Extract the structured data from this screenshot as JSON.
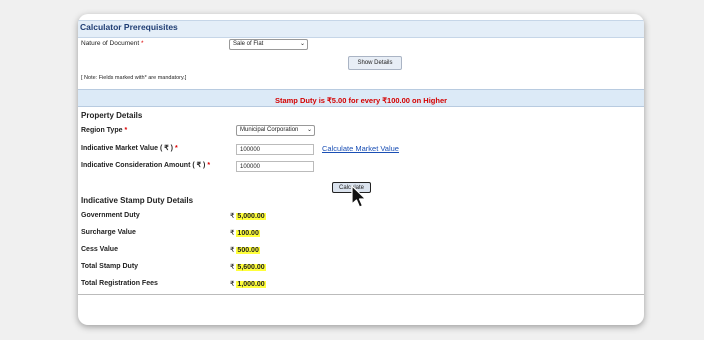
{
  "prereq": {
    "header": "Calculator Prerequisites",
    "nature_label": "Nature of Document",
    "required_mark": "*",
    "nature_value": "Sale of Flat",
    "show_details_button": "Show Details",
    "note": "[ Note: Fields marked with* are mandatory.]"
  },
  "banner": "Stamp Duty is ₹5.00 for every ₹100.00 on Higher",
  "property": {
    "title": "Property Details",
    "region_label": "Region Type",
    "region_value": "Municipal Corporation",
    "market_label": "Indicative Market Value ( ₹ )",
    "market_value": "100000",
    "calc_market_link": "Calculate Market Value",
    "consideration_label": "Indicative Consideration Amount ( ₹ )",
    "consideration_value": "100000",
    "calculate_button": "Calculate"
  },
  "results": {
    "title": "Indicative Stamp Duty Details",
    "currency": "₹",
    "rows": [
      {
        "label": "Government Duty",
        "value": "5,000.00"
      },
      {
        "label": "Surcharge Value",
        "value": "100.00"
      },
      {
        "label": "Cess Value",
        "value": "500.00"
      },
      {
        "label": "Total Stamp Duty",
        "value": "5,600.00"
      },
      {
        "label": "Total Registration Fees",
        "value": "1,000.00"
      }
    ]
  },
  "icons": {
    "dropdown": "chevron-down-icon",
    "pointer": "mouse-pointer-icon"
  },
  "colors": {
    "header_bg": "#e4eef8",
    "header_text": "#1f3d73",
    "banner_text": "#d40000",
    "highlight": "#ffff3a",
    "link": "#1a4fb5"
  }
}
